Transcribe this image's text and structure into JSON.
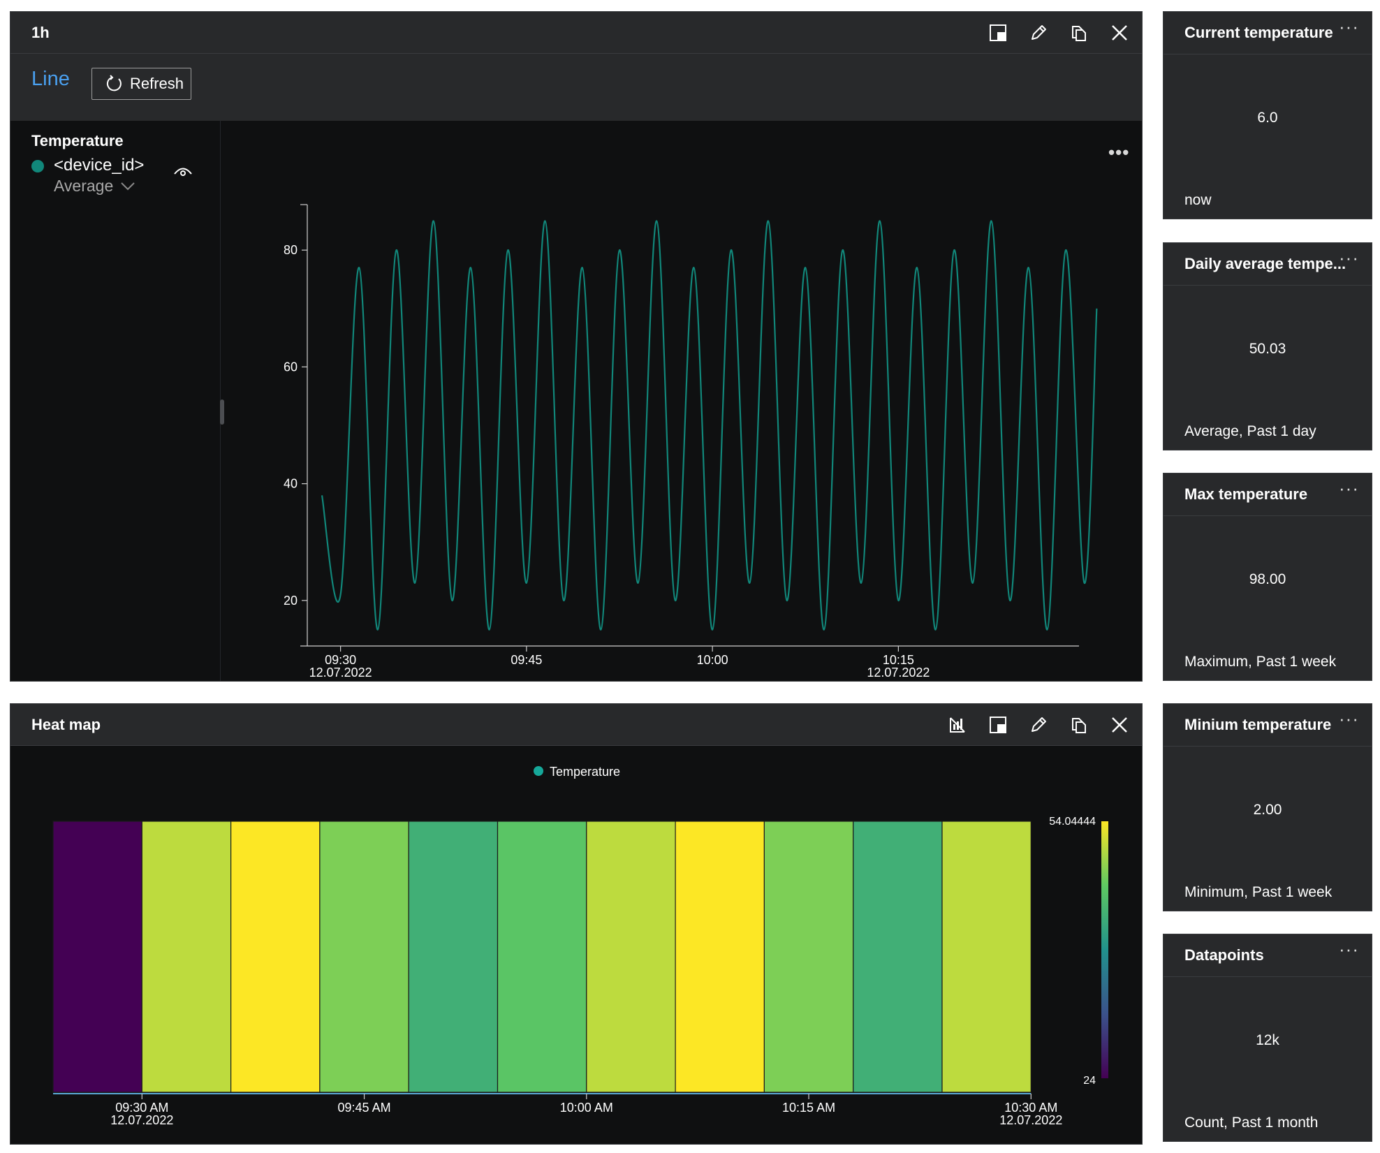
{
  "line_tile": {
    "title": "1h",
    "mode_label": "Line",
    "refresh_label": "Refresh",
    "legend": {
      "title": "Temperature",
      "series": "<device_id>",
      "aggregation": "Average"
    },
    "series_color": "#11877a",
    "more_label": "•••"
  },
  "heatmap_tile": {
    "title": "Heat map",
    "legend_label": "Temperature",
    "legend_color": "#16a89a",
    "scale_max": "54.04444",
    "scale_min": "24"
  },
  "chart_data": [
    {
      "type": "line",
      "title": "",
      "series": [
        {
          "name": "<device_id>",
          "x_minutes": [
            0,
            1.5,
            3,
            4.5,
            6,
            7.5,
            9,
            10.5,
            12,
            13.5,
            15,
            16.5,
            18,
            19.5,
            21,
            22.5,
            24,
            25.5,
            27,
            28.5,
            30,
            31.5,
            33,
            34.5,
            36,
            37.5,
            39,
            40.5,
            42,
            43.5,
            45,
            46.5,
            48,
            49.5,
            51,
            52.5,
            54,
            55.5,
            57,
            58.5,
            60,
            61.5,
            62.5
          ],
          "values": [
            38,
            21,
            77,
            15,
            80,
            23,
            85,
            20,
            77,
            15,
            80,
            23,
            85,
            20,
            77,
            15,
            80,
            23,
            85,
            20,
            77,
            15,
            80,
            23,
            85,
            20,
            77,
            15,
            80,
            23,
            85,
            20,
            77,
            15,
            80,
            23,
            85,
            20,
            77,
            15,
            80,
            23,
            70
          ]
        }
      ],
      "y_ticks": [
        20,
        40,
        60,
        80
      ],
      "ylim": [
        14,
        86
      ],
      "x_ticks": [
        {
          "label": "09:30",
          "date": "12.07.2022"
        },
        {
          "label": "09:45",
          "date": ""
        },
        {
          "label": "10:00",
          "date": ""
        },
        {
          "label": "10:15",
          "date": "12.07.2022"
        }
      ]
    },
    {
      "type": "heatmap",
      "series": [
        {
          "name": "Temperature",
          "values": [
            24,
            51,
            54,
            48,
            43,
            46,
            51,
            54,
            48,
            43,
            51
          ]
        }
      ],
      "vlim": [
        24,
        54.04444
      ],
      "x_ticks": [
        {
          "label": "09:30 AM",
          "date": "12.07.2022"
        },
        {
          "label": "09:45 AM",
          "date": ""
        },
        {
          "label": "10:00 AM",
          "date": ""
        },
        {
          "label": "10:15 AM",
          "date": ""
        },
        {
          "label": "10:30 AM",
          "date": "12.07.2022"
        }
      ]
    }
  ],
  "cards": [
    {
      "title": "Current temperature",
      "value": "6.0",
      "subtitle": "now"
    },
    {
      "title": "Daily average tempe...",
      "value": "50.03",
      "subtitle": "Average, Past 1 day"
    },
    {
      "title": "Max temperature",
      "value": "98.00",
      "subtitle": "Maximum, Past 1 week"
    },
    {
      "title": "Minium temperature",
      "value": "2.00",
      "subtitle": "Minimum, Past 1 week"
    },
    {
      "title": "Datapoints",
      "value": "12k",
      "subtitle": "Count, Past 1 month"
    }
  ],
  "icons": {
    "line_tile": [
      "pop-out-icon",
      "edit-icon",
      "copy-icon",
      "close-icon"
    ],
    "heatmap_tile": [
      "chart-settings-icon",
      "pop-out-icon",
      "edit-icon",
      "copy-icon",
      "close-icon"
    ]
  }
}
